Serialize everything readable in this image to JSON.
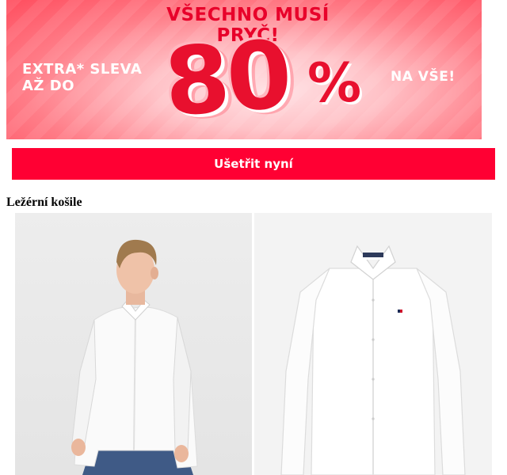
{
  "banner": {
    "headline": "VŠECHNO MUSÍ PRYČ!",
    "extra_line1": "EXTRA* SLEVA",
    "extra_line2": "AŽ DO",
    "discount_number": "80",
    "percent_sign": "%",
    "suffix": "NA VŠE!"
  },
  "cta": {
    "label": "Ušetřit nyní"
  },
  "section": {
    "title": "Ležérní košile"
  },
  "products": [
    {
      "image": "man-in-white-shirt"
    },
    {
      "image": "white-shirt-flat"
    }
  ],
  "colors": {
    "accent": "#ff0033",
    "banner_text": "#e8102e"
  }
}
